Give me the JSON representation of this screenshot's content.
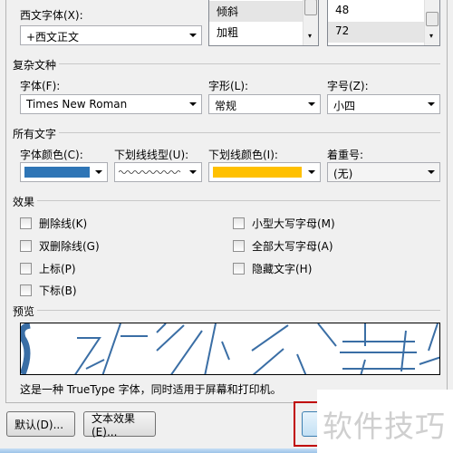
{
  "latin": {
    "label": "西文字体(X):",
    "value": "+西文正文"
  },
  "style_list": {
    "items": [
      "倾斜",
      "加粗"
    ],
    "selected": "倾斜"
  },
  "size_list": {
    "items": [
      "48",
      "72"
    ],
    "selected": "72"
  },
  "complex": {
    "section": "复杂文种",
    "font_label": "字体(F):",
    "font_value": "Times New Roman",
    "style_label": "字形(L):",
    "style_value": "常规",
    "size_label": "字号(Z):",
    "size_value": "小四"
  },
  "all_text": {
    "section": "所有文字",
    "color_label": "字体颜色(C):",
    "color": "#2e75b6",
    "underline_label": "下划线线型(U):",
    "underline_color_label": "下划线颜色(I):",
    "underline_color": "#ffc000",
    "emphasis_label": "着重号:",
    "emphasis_value": "(无)"
  },
  "effects": {
    "section": "效果",
    "left": [
      "删除线(K)",
      "双删除线(G)",
      "上标(P)",
      "下标(B)"
    ],
    "right": [
      "小型大写字母(M)",
      "全部大写字母(A)",
      "隐藏文字(H)"
    ]
  },
  "preview": {
    "section": "预览",
    "note": "这是一种 TrueType 字体，同时适用于屏幕和打印机。",
    "stroke_color": "#3a6ea5"
  },
  "buttons": {
    "default": "默认(D)...",
    "text_effects": "文本效果(E)..."
  },
  "watermark": "软件技巧"
}
